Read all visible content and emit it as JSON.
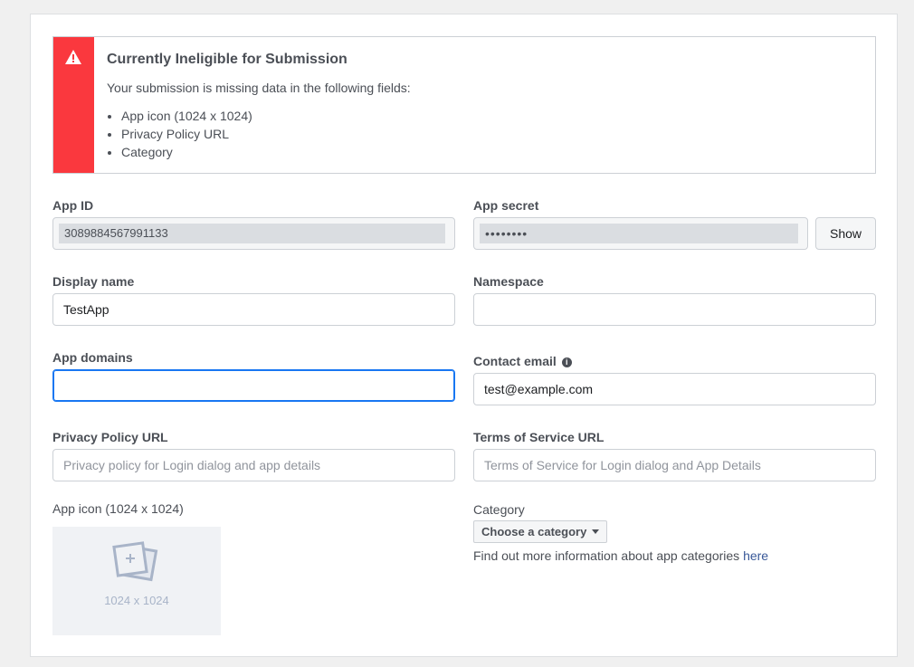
{
  "alert": {
    "title": "Currently Ineligible for Submission",
    "message": "Your submission is missing data in the following fields:",
    "missing": [
      "App icon (1024 x 1024)",
      "Privacy Policy URL",
      "Category"
    ],
    "accent_color": "#fa383e"
  },
  "app_id": {
    "label": "App ID",
    "value": "3089884567991133"
  },
  "app_secret": {
    "label": "App secret",
    "value": "••••••••",
    "show_label": "Show"
  },
  "display_name": {
    "label": "Display name",
    "value": "TestApp"
  },
  "namespace": {
    "label": "Namespace",
    "value": ""
  },
  "app_domains": {
    "label": "App domains",
    "value": ""
  },
  "contact_email": {
    "label": "Contact email",
    "info_icon": "i",
    "value": "test@example.com"
  },
  "privacy_url": {
    "label": "Privacy Policy URL",
    "placeholder": "Privacy policy for Login dialog and app details"
  },
  "tos_url": {
    "label": "Terms of Service URL",
    "placeholder": "Terms of Service for Login dialog and App Details"
  },
  "app_icon": {
    "label": "App icon (1024 x 1024)",
    "size_text": "1024 x 1024"
  },
  "category": {
    "label": "Category",
    "button_label": "Choose a category",
    "help_text": "Find out more information about app categories ",
    "help_link": "here"
  }
}
